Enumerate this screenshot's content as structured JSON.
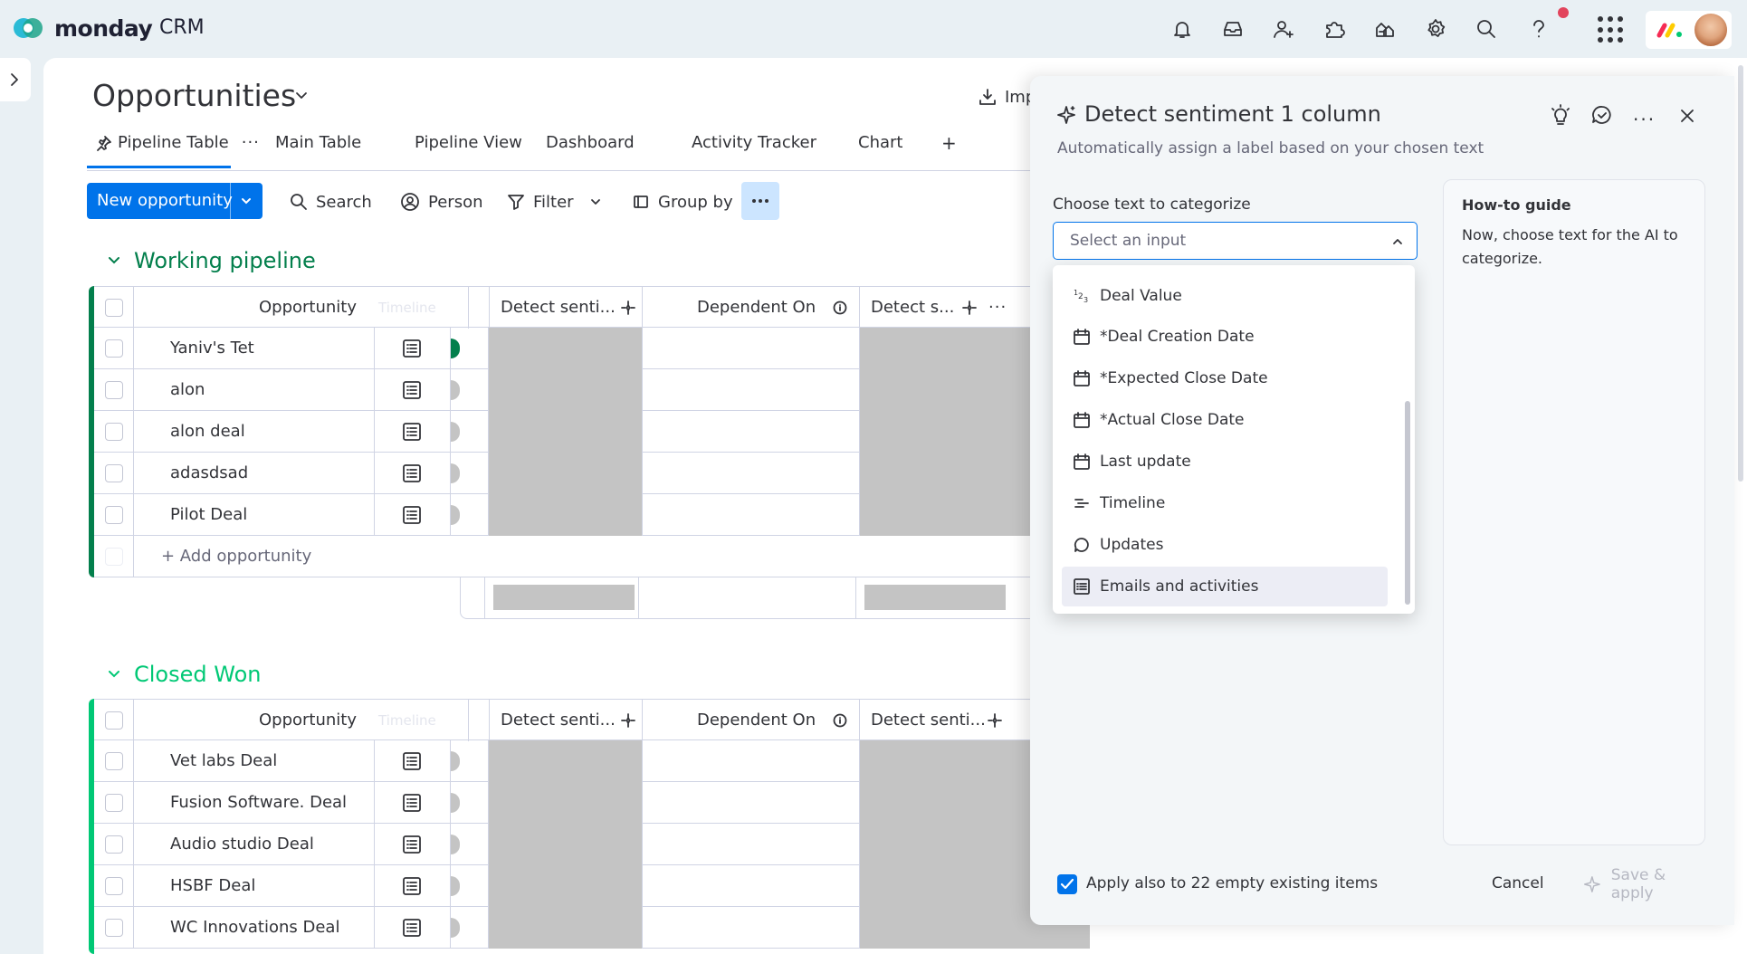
{
  "app": {
    "brand": "monday",
    "product": "CRM"
  },
  "board": {
    "title": "Opportunities",
    "import_label": "Imp",
    "tabs": [
      {
        "label": "Pipeline Table",
        "active": true
      },
      {
        "label": "Main Table"
      },
      {
        "label": "Pipeline View"
      },
      {
        "label": "Dashboard"
      },
      {
        "label": "Activity Tracker"
      },
      {
        "label": "Chart"
      }
    ],
    "add_tab": "+"
  },
  "toolbar": {
    "new_item": "New opportunity",
    "search": "Search",
    "person": "Person",
    "filter": "Filter",
    "group_by": "Group by"
  },
  "groups": [
    {
      "title": "Working pipeline",
      "color": "#037f4c",
      "columns": {
        "name": "Opportunity",
        "ghost": "Timeline",
        "sentiment": "Detect senti...",
        "dependent": "Dependent On",
        "sentiment2": "Detect s..."
      },
      "rows": [
        "Yaniv's Tet",
        "alon",
        "alon deal",
        "adasdsad",
        "Pilot Deal"
      ],
      "add_label": "+ Add opportunity"
    },
    {
      "title": "Closed Won",
      "color": "#00c875",
      "columns": {
        "name": "Opportunity",
        "ghost": "Timeline",
        "sentiment": "Detect senti...",
        "dependent": "Dependent On",
        "sentiment2": "Detect senti..."
      },
      "rows": [
        "Vet labs Deal",
        "Fusion Software. Deal",
        "Audio studio Deal",
        "HSBF Deal",
        "WC Innovations Deal"
      ]
    }
  ],
  "panel": {
    "title": "Detect sentiment 1 column",
    "subtitle": "Automatically assign a label based on your chosen text",
    "choose_label": "Choose text to categorize",
    "select_placeholder": "Select an input",
    "options": [
      {
        "icon": "numbers-icon",
        "label": "Deal Value"
      },
      {
        "icon": "calendar-icon",
        "label": "*Deal Creation Date"
      },
      {
        "icon": "calendar-icon",
        "label": "*Expected Close Date"
      },
      {
        "icon": "calendar-icon",
        "label": "*Actual Close Date"
      },
      {
        "icon": "calendar-icon",
        "label": "Last update"
      },
      {
        "icon": "timeline-icon",
        "label": "Timeline"
      },
      {
        "icon": "speech-bubble-icon",
        "label": "Updates"
      },
      {
        "icon": "emails-list-icon",
        "label": "Emails and activities",
        "highlighted": true
      }
    ],
    "howto_title": "How-to guide",
    "howto_body": "Now, choose text for the AI to categorize.",
    "apply_label": "Apply also to 22 empty existing items",
    "apply_checked": true,
    "cancel": "Cancel",
    "save": "Save & apply"
  },
  "colors": {
    "accent": "#0073ea",
    "working": "#037f4c",
    "won": "#00c875"
  }
}
